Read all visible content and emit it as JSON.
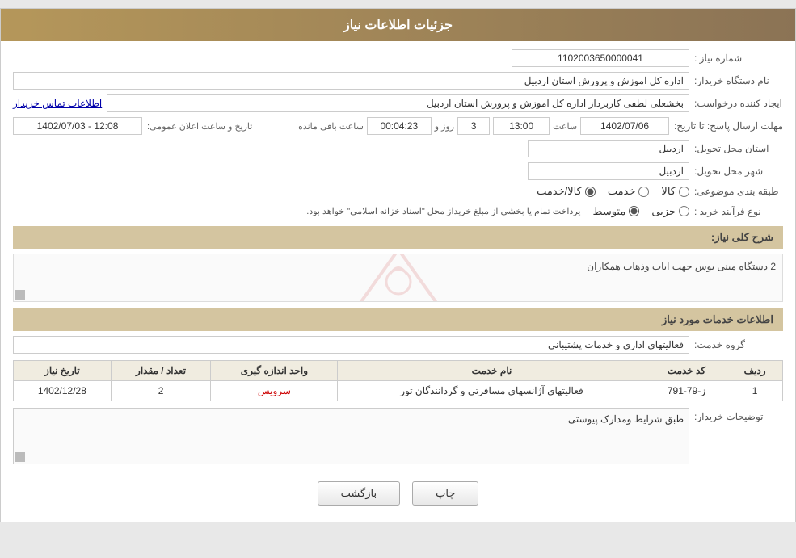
{
  "header": {
    "title": "جزئیات اطلاعات نیاز"
  },
  "fields": {
    "shomareNiaz_label": "شماره نیاز :",
    "shomareNiaz_value": "1102003650000041",
    "namDastgah_label": "نام دستگاه خریدار:",
    "namDastgah_value": "اداره کل اموزش و پرورش استان اردبیل",
    "ijadKonande_label": "ایجاد کننده درخواست:",
    "ijadKonande_value": "بخشعلی لطفی کاربرداز اداره کل اموزش و پرورش استان اردبیل",
    "ijadKonande_link": "اطلاعات تماس خریدار",
    "mohlatErsalPasokh_label": "مهلت ارسال پاسخ: تا تاریخ:",
    "tarikh_value": "1402/07/06",
    "saat_label": "ساعت",
    "saat_value": "13:00",
    "rooz_label": "روز و",
    "rooz_value": "3",
    "baghiMande_label": "ساعت باقی مانده",
    "baghiMande_value": "00:04:23",
    "tarikh_ilan_label": "تاریخ و ساعت اعلان عمومی:",
    "tarikh_ilan_value": "1402/07/03 - 12:08",
    "ostan_label": "استان محل تحویل:",
    "ostan_value": "اردبیل",
    "shahr_label": "شهر محل تحویل:",
    "shahr_value": "اردبیل",
    "tabaghe_label": "طبقه بندی موضوعی:",
    "tabaghe_kala": "کالا",
    "tabaghe_khadamat": "خدمت",
    "tabaghe_kalaKhadamat": "کالا/خدمت",
    "noFarayand_label": "نوع فرآیند خرید :",
    "noFarayand_jazii": "جزیی",
    "noFarayand_mottavasset": "متوسط",
    "noFarayand_desc": "پرداخت تمام یا بخشی از مبلغ خریداز محل \"اسناد خزانه اسلامی\" خواهد بود.",
    "sharh_label": "شرح کلی نیاز:",
    "sharh_value": "2 دستگاه مینی بوس جهت ایاب وذهاب همکاران",
    "khadamat_label": "اطلاعات خدمات مورد نیاز",
    "groheKhadamat_label": "گروه خدمت:",
    "groheKhadamat_value": "فعالیتهای اداری و خدمات پشتیبانی"
  },
  "table": {
    "headers": [
      "ردیف",
      "کد خدمت",
      "نام خدمت",
      "واحد اندازه گیری",
      "تعداد / مقدار",
      "تاریخ نیاز"
    ],
    "rows": [
      {
        "radif": "1",
        "kodKhadamat": "ز-79-791",
        "namKhadamat": "فعالیتهای آژانسهای مسافرتی و گردانندگان تور",
        "vahed": "سرویس",
        "tedad": "2",
        "tarikh": "1402/12/28"
      }
    ]
  },
  "tozihat": {
    "label": "توضیحات خریدار:",
    "value": "طبق شرایط ومدارک پیوستی"
  },
  "buttons": {
    "print_label": "چاپ",
    "back_label": "بازگشت"
  }
}
